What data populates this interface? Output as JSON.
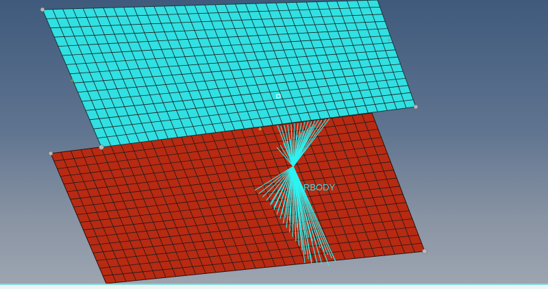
{
  "viewport": {
    "rigid_body_label": "RBODY",
    "label_color": "#39e1e4",
    "top_plate_color": "#31e0e2",
    "bottom_plate_color": "#b82a12",
    "mesh_line_color": "#1a1a1a",
    "rbody_spider_color": "#2ef2f2"
  }
}
